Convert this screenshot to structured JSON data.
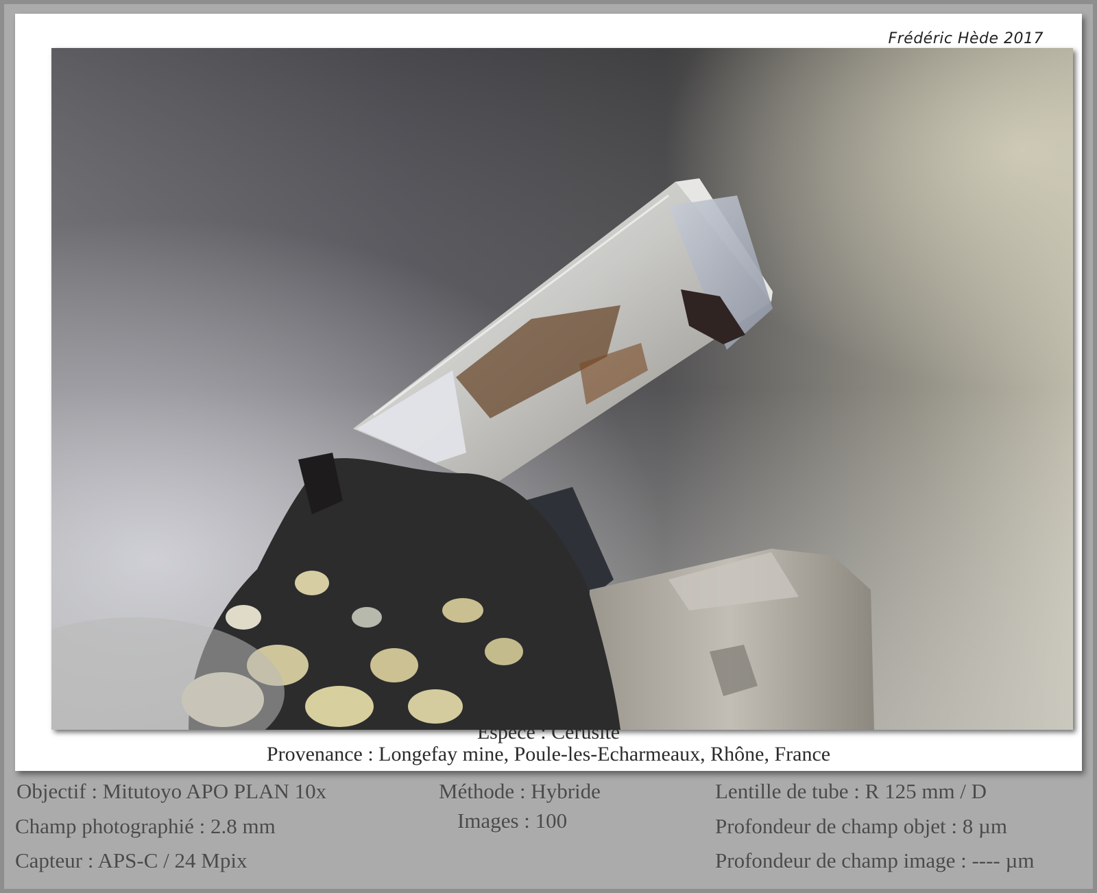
{
  "signature": "Frédéric Hède 2017",
  "caption": {
    "species": "Espèce : Cérusite",
    "provenance": "Provenance : Longefay mine, Poule-les-Echarmeaux, Rhône, France"
  },
  "specs": {
    "left": {
      "objective": "Objectif : Mitutoyo APO PLAN 10x",
      "field": "Champ photographié : 2.8 mm",
      "sensor": "Capteur : APS-C / 24 Mpix"
    },
    "center": {
      "method": "Méthode : Hybride",
      "images": "Images : 100"
    },
    "right": {
      "tube_lens": "Lentille de tube : R 125 mm / D",
      "object_dof": "Profondeur de champ objet : 8 µm",
      "image_dof": "Profondeur de champ image : ---- µm"
    }
  },
  "colors": {
    "background_frame": "#ababab",
    "mat": "#ffffff",
    "caption_text": "#2b2b2b",
    "spec_text": "#4a4a4a"
  }
}
